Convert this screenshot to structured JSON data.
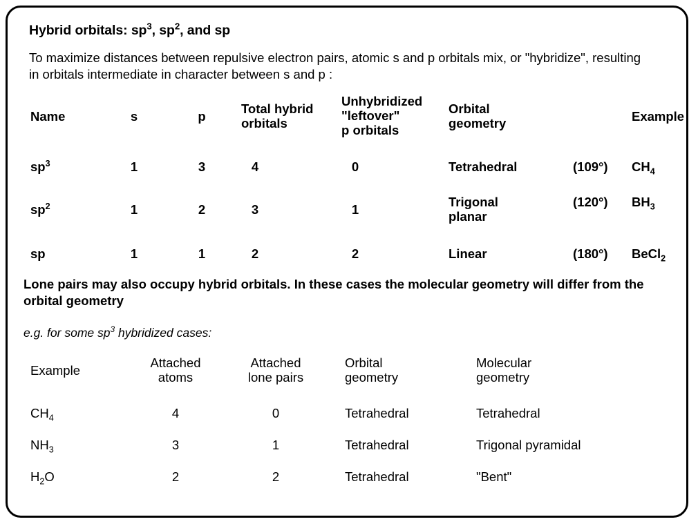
{
  "slide": {
    "title_html": "Hybrid orbitals: sp3, sp2, and sp",
    "title_plain": "Hybrid orbitals: sp3, sp2, and sp",
    "intro": "To maximize distances between repulsive electron pairs, atomic s and p orbitals mix, or \"hybridize\", resulting in orbitals intermediate in character between s and p :",
    "note": "Lone pairs may also occupy hybrid orbitals. In these cases the molecular geometry will differ from the orbital geometry",
    "eg_line": "e.g. for some sp3 hybridized cases:"
  },
  "table1": {
    "headers": {
      "name": "Name",
      "s": "s",
      "p": "p",
      "total_hybrid": "Total hybrid\norbitals",
      "unhybridized": "Unhybridized\n\"leftover\"\np orbitals",
      "orbital_geometry": "Orbital\ngeometry",
      "angle": "",
      "example": "Example"
    },
    "rows": [
      {
        "name_base": "sp",
        "name_sup": "3",
        "s": "1",
        "p": "3",
        "total_hybrid": "4",
        "unhybridized": "0",
        "orbital_geometry": "Tetrahedral",
        "angle": "(109°)",
        "example_base": "CH",
        "example_sub": "4"
      },
      {
        "name_base": "sp",
        "name_sup": "2",
        "s": "1",
        "p": "2",
        "total_hybrid": "3",
        "unhybridized": "1",
        "orbital_geometry": "Trigonal\n planar",
        "angle": "(120°)",
        "example_base": "BH",
        "example_sub": "3"
      },
      {
        "name_base": "sp",
        "name_sup": "",
        "s": "1",
        "p": "1",
        "total_hybrid": "2",
        "unhybridized": "2",
        "orbital_geometry": "Linear",
        "angle": "(180°)",
        "example_base": "BeCl",
        "example_sub": "2"
      }
    ]
  },
  "table2": {
    "headers": {
      "example": "Example",
      "attached_atoms": "Attached\natoms",
      "attached_lone_pairs": "Attached\nlone pairs",
      "orbital_geometry": "Orbital\ngeometry",
      "molecular_geometry": "Molecular\ngeometry"
    },
    "rows": [
      {
        "example_base": "CH",
        "example_sub": "4",
        "attached_atoms": "4",
        "attached_lone_pairs": "0",
        "orbital_geometry": "Tetrahedral",
        "molecular_geometry": "Tetrahedral"
      },
      {
        "example_base": "NH",
        "example_sub": "3",
        "attached_atoms": "3",
        "attached_lone_pairs": "1",
        "orbital_geometry": "Tetrahedral",
        "molecular_geometry": "Trigonal pyramidal"
      },
      {
        "example_base": "H",
        "example_sub": "2",
        "example_tail": "O",
        "attached_atoms": "2",
        "attached_lone_pairs": "2",
        "orbital_geometry": "Tetrahedral",
        "molecular_geometry": "\"Bent\""
      }
    ]
  },
  "colors": {
    "border": "#000000",
    "text": "#000000",
    "background": "#ffffff"
  }
}
